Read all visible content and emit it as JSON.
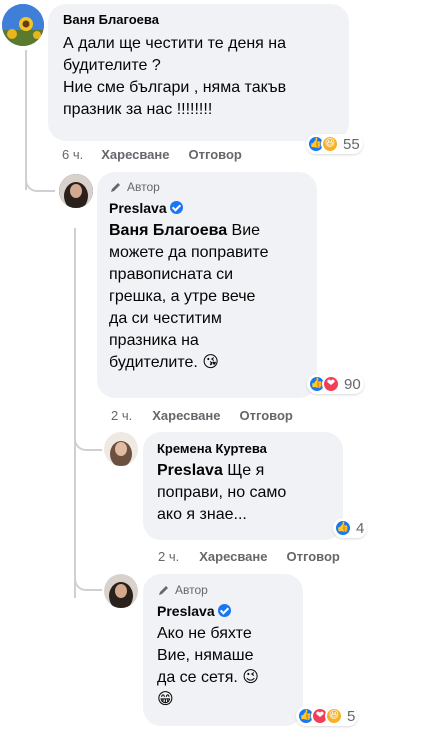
{
  "comment_1": {
    "author": "Ваня Благоева",
    "text_line_1": "А дали ще честити те деня на",
    "text_line_2": "будителите ?",
    "text_line_3": "Ние сме българи , няма такъв",
    "text_line_4": "празник за нас !!!!!!!!",
    "reaction_count": "55",
    "time": "6 ч.",
    "like_label": "Харесване",
    "reply_label": "Отговор"
  },
  "reply_1": {
    "author_badge": "Автор",
    "author": "Preslava",
    "mention": "Ваня Благоева",
    "text_after_mention": " Вие",
    "text_line_2": "можете да поправите",
    "text_line_3": "правописната си",
    "text_line_4": "грешка, а утре вече",
    "text_line_5": "да си честитим",
    "text_line_6": "празника на",
    "text_line_7": "будителите.",
    "emoji": "😘",
    "reaction_count": "90",
    "time": "2 ч.",
    "like_label": "Харесване",
    "reply_label": "Отговор"
  },
  "reply_2": {
    "author": "Кремена Куртева",
    "mention": "Preslava",
    "text_after_mention": " Ще я",
    "text_line_2": "поправи, но само",
    "text_line_3": "ако я знае...",
    "reaction_count": "4",
    "time": "2 ч.",
    "like_label": "Харесване",
    "reply_label": "Отговор"
  },
  "reply_3": {
    "author_badge": "Автор",
    "author": "Preslava",
    "text_line_1": "Ако не бяхте",
    "text_line_2": "Вие, нямаше",
    "text_line_3": "да се сетя.",
    "emoji_1": "😉",
    "emoji_2": "😁",
    "reaction_count": "5"
  },
  "colors": {
    "bubble": "#f0f2f5",
    "meta_text": "#65676b",
    "like_blue": "#1877f2",
    "love_red": "#f33e58",
    "haha_yellow": "#f7b125",
    "thread_line": "#ced0d4"
  },
  "icons": {
    "author_badge": "pencil-icon",
    "verified": "verified-check-icon",
    "reaction_like": "thumbs-up-icon",
    "reaction_love": "heart-icon",
    "reaction_haha": "laughing-face-icon"
  }
}
